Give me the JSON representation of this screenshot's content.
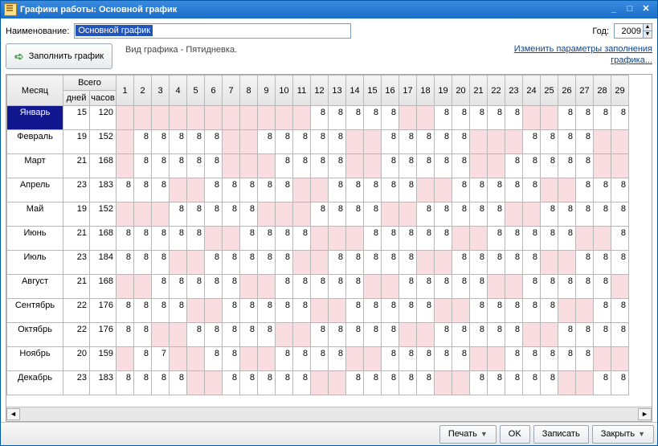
{
  "titlebar": {
    "title": "Графики работы: Основной график"
  },
  "labels": {
    "name": "Наименование:",
    "year": "Год:",
    "fill": "Заполнить график",
    "schedule_type": "Вид графика - Пятидневка.",
    "change_params_l1": "Изменить параметры заполнения",
    "change_params_l2": "графика...",
    "month_header": "Месяц",
    "total_header": "Всего",
    "days_header": "дней",
    "hours_header": "часов"
  },
  "name_value": "Основной график",
  "year_value": "2009",
  "footer": {
    "print": "Печать",
    "ok": "OK",
    "save": "Записать",
    "close": "Закрыть"
  },
  "days": [
    "1",
    "2",
    "3",
    "4",
    "5",
    "6",
    "7",
    "8",
    "9",
    "10",
    "11",
    "12",
    "13",
    "14",
    "15",
    "16",
    "17",
    "18",
    "19",
    "20",
    "21",
    "22",
    "23",
    "24",
    "25",
    "26",
    "27",
    "28",
    "29"
  ],
  "months": [
    {
      "name": "Январь",
      "days": "15",
      "hours": "120",
      "cells": [
        "",
        "",
        "",
        "",
        "",
        "",
        "",
        "",
        "",
        "",
        "",
        "8",
        "8",
        "8",
        "8",
        "8",
        "",
        "",
        "8",
        "8",
        "8",
        "8",
        "8",
        "",
        "",
        "8",
        "8",
        "8",
        "8"
      ]
    },
    {
      "name": "Февраль",
      "days": "19",
      "hours": "152",
      "cells": [
        "",
        "8",
        "8",
        "8",
        "8",
        "8",
        "",
        "",
        "8",
        "8",
        "8",
        "8",
        "8",
        "",
        "",
        "8",
        "8",
        "8",
        "8",
        "8",
        "",
        "",
        "",
        "8",
        "8",
        "8",
        "8",
        "",
        ""
      ]
    },
    {
      "name": "Март",
      "days": "21",
      "hours": "168",
      "cells": [
        "",
        "8",
        "8",
        "8",
        "8",
        "8",
        "",
        "",
        "",
        "8",
        "8",
        "8",
        "8",
        "",
        "",
        "8",
        "8",
        "8",
        "8",
        "8",
        "",
        "",
        "8",
        "8",
        "8",
        "8",
        "8",
        "",
        ""
      ]
    },
    {
      "name": "Апрель",
      "days": "23",
      "hours": "183",
      "cells": [
        "8",
        "8",
        "8",
        "",
        "",
        "8",
        "8",
        "8",
        "8",
        "8",
        "",
        "",
        "8",
        "8",
        "8",
        "8",
        "8",
        "",
        "",
        "8",
        "8",
        "8",
        "8",
        "8",
        "",
        "",
        "8",
        "8",
        "8"
      ]
    },
    {
      "name": "Май",
      "days": "19",
      "hours": "152",
      "cells": [
        "",
        "",
        "",
        "8",
        "8",
        "8",
        "8",
        "8",
        "",
        "",
        "",
        "8",
        "8",
        "8",
        "8",
        "",
        "",
        "8",
        "8",
        "8",
        "8",
        "8",
        "",
        "",
        "8",
        "8",
        "8",
        "8",
        "8"
      ]
    },
    {
      "name": "Июнь",
      "days": "21",
      "hours": "168",
      "cells": [
        "8",
        "8",
        "8",
        "8",
        "8",
        "",
        "",
        "8",
        "8",
        "8",
        "8",
        "",
        "",
        "",
        "8",
        "8",
        "8",
        "8",
        "8",
        "",
        "",
        "8",
        "8",
        "8",
        "8",
        "8",
        "",
        "",
        "8"
      ]
    },
    {
      "name": "Июль",
      "days": "23",
      "hours": "184",
      "cells": [
        "8",
        "8",
        "8",
        "",
        "",
        "8",
        "8",
        "8",
        "8",
        "8",
        "",
        "",
        "8",
        "8",
        "8",
        "8",
        "8",
        "",
        "",
        "8",
        "8",
        "8",
        "8",
        "8",
        "",
        "",
        "8",
        "8",
        "8"
      ]
    },
    {
      "name": "Август",
      "days": "21",
      "hours": "168",
      "cells": [
        "",
        "",
        "8",
        "8",
        "8",
        "8",
        "8",
        "",
        "",
        "8",
        "8",
        "8",
        "8",
        "8",
        "",
        "",
        "8",
        "8",
        "8",
        "8",
        "8",
        "",
        "",
        "8",
        "8",
        "8",
        "8",
        "8",
        ""
      ]
    },
    {
      "name": "Сентябрь",
      "days": "22",
      "hours": "176",
      "cells": [
        "8",
        "8",
        "8",
        "8",
        "",
        "",
        "8",
        "8",
        "8",
        "8",
        "8",
        "",
        "",
        "8",
        "8",
        "8",
        "8",
        "8",
        "",
        "",
        "8",
        "8",
        "8",
        "8",
        "8",
        "",
        "",
        "8",
        "8"
      ]
    },
    {
      "name": "Октябрь",
      "days": "22",
      "hours": "176",
      "cells": [
        "8",
        "8",
        "",
        "",
        "8",
        "8",
        "8",
        "8",
        "8",
        "",
        "",
        "8",
        "8",
        "8",
        "8",
        "8",
        "",
        "",
        "8",
        "8",
        "8",
        "8",
        "8",
        "",
        "",
        "8",
        "8",
        "8",
        "8"
      ]
    },
    {
      "name": "Ноябрь",
      "days": "20",
      "hours": "159",
      "cells": [
        "",
        "8",
        "7",
        "",
        "",
        "8",
        "8",
        "",
        "",
        "8",
        "8",
        "8",
        "8",
        "",
        "",
        "8",
        "8",
        "8",
        "8",
        "8",
        "",
        "",
        "8",
        "8",
        "8",
        "8",
        "8",
        "",
        ""
      ]
    },
    {
      "name": "Декабрь",
      "days": "23",
      "hours": "183",
      "cells": [
        "8",
        "8",
        "8",
        "8",
        "",
        "",
        "8",
        "8",
        "8",
        "8",
        "8",
        "",
        "",
        "8",
        "8",
        "8",
        "8",
        "8",
        "",
        "",
        "8",
        "8",
        "8",
        "8",
        "8",
        "",
        "",
        "8",
        "8"
      ]
    }
  ]
}
